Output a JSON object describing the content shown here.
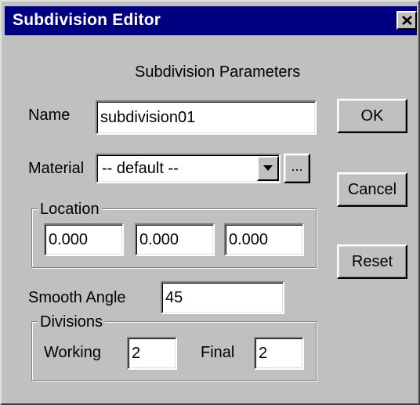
{
  "window": {
    "title": "Subdivision Editor",
    "close_icon": "close-x-icon"
  },
  "header": {
    "text": "Subdivision Parameters"
  },
  "form": {
    "name_label": "Name",
    "name_value": "subdivision01",
    "material_label": "Material",
    "material_value": "-- default --",
    "material_browse_label": "...",
    "location_label": "Location",
    "location_x": "0.000",
    "location_y": "0.000",
    "location_z": "0.000",
    "smooth_angle_label": "Smooth Angle",
    "smooth_angle_value": "45",
    "divisions_label": "Divisions",
    "working_label": "Working",
    "working_value": "2",
    "final_label": "Final",
    "final_value": "2"
  },
  "buttons": {
    "ok": "OK",
    "cancel": "Cancel",
    "reset": "Reset"
  },
  "colors": {
    "titlebar": "#000080",
    "face": "#c0c0c0"
  }
}
